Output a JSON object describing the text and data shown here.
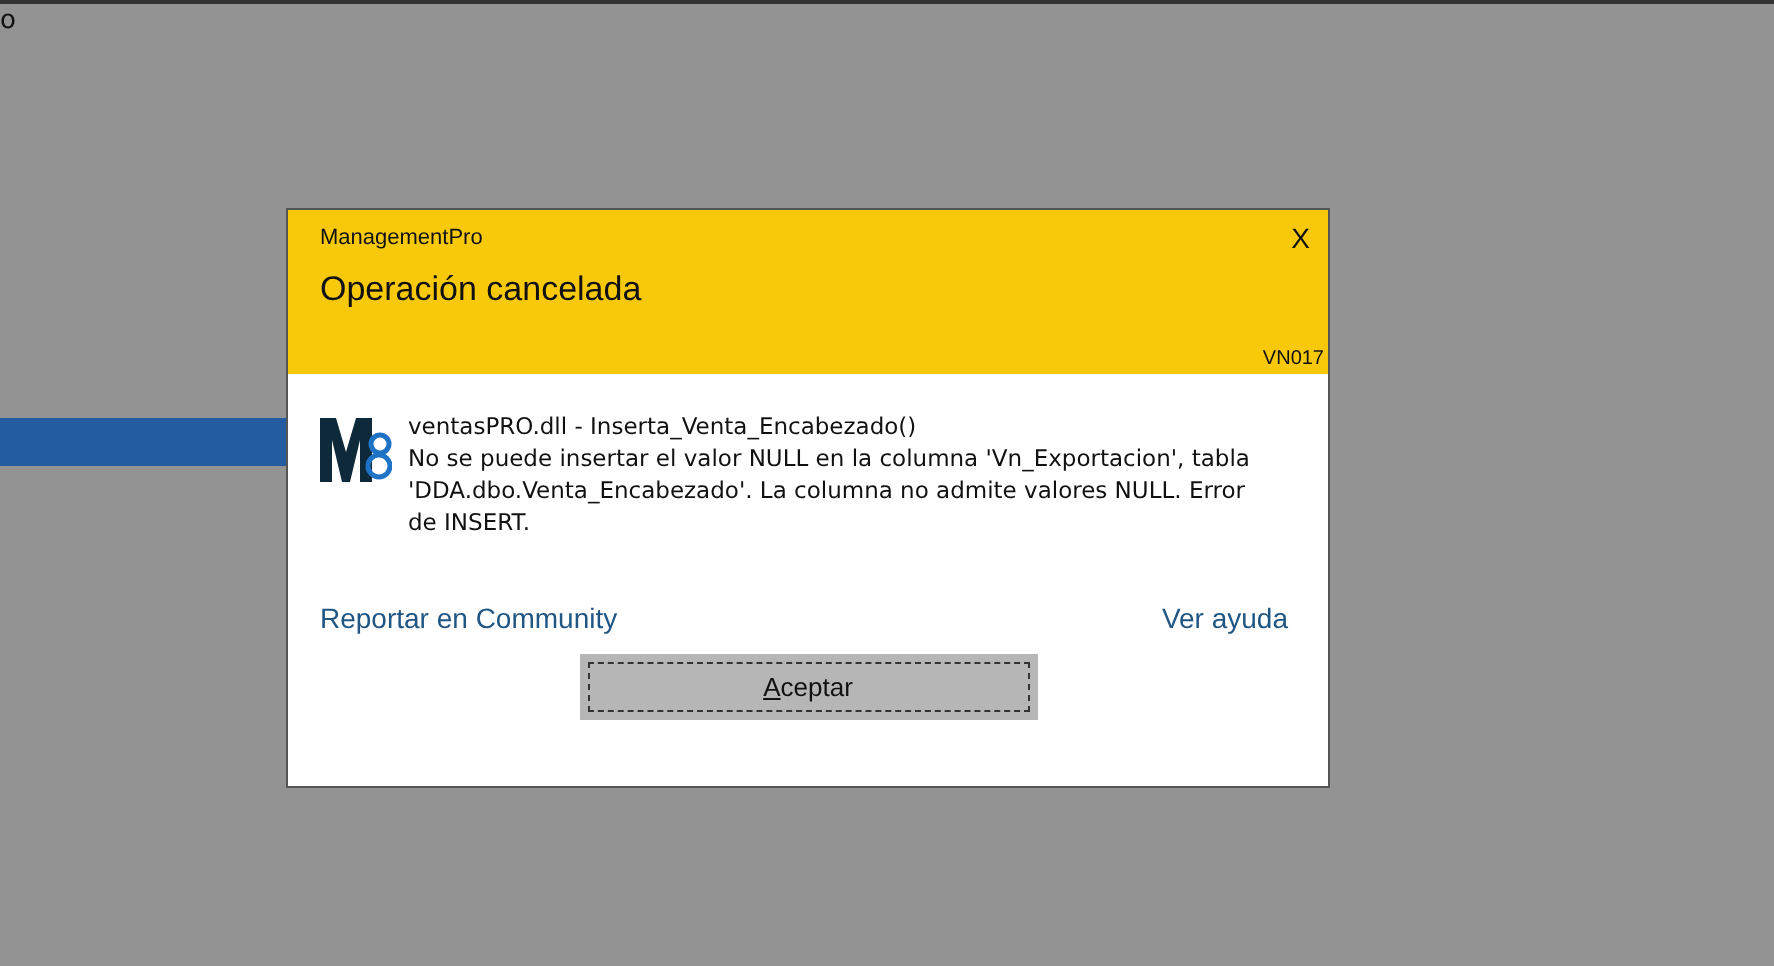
{
  "background": {
    "text": "o"
  },
  "dialog": {
    "app_name": "ManagementPro",
    "title": "Operación cancelada",
    "close": "X",
    "code": "VN017",
    "message_title": "ventasPRO.dll - Inserta_Venta_Encabezado()",
    "message": "No se puede insertar el valor NULL en la columna 'Vn_Exportacion', tabla 'DDA.dbo.Venta_Encabezado'. La columna no admite valores NULL. Error de INSERT.",
    "links": [
      "Reportar en Community",
      "Ver ayuda"
    ],
    "button": {
      "label": "Aceptar",
      "mnemonic_underlined": true,
      "focused": true
    }
  }
}
